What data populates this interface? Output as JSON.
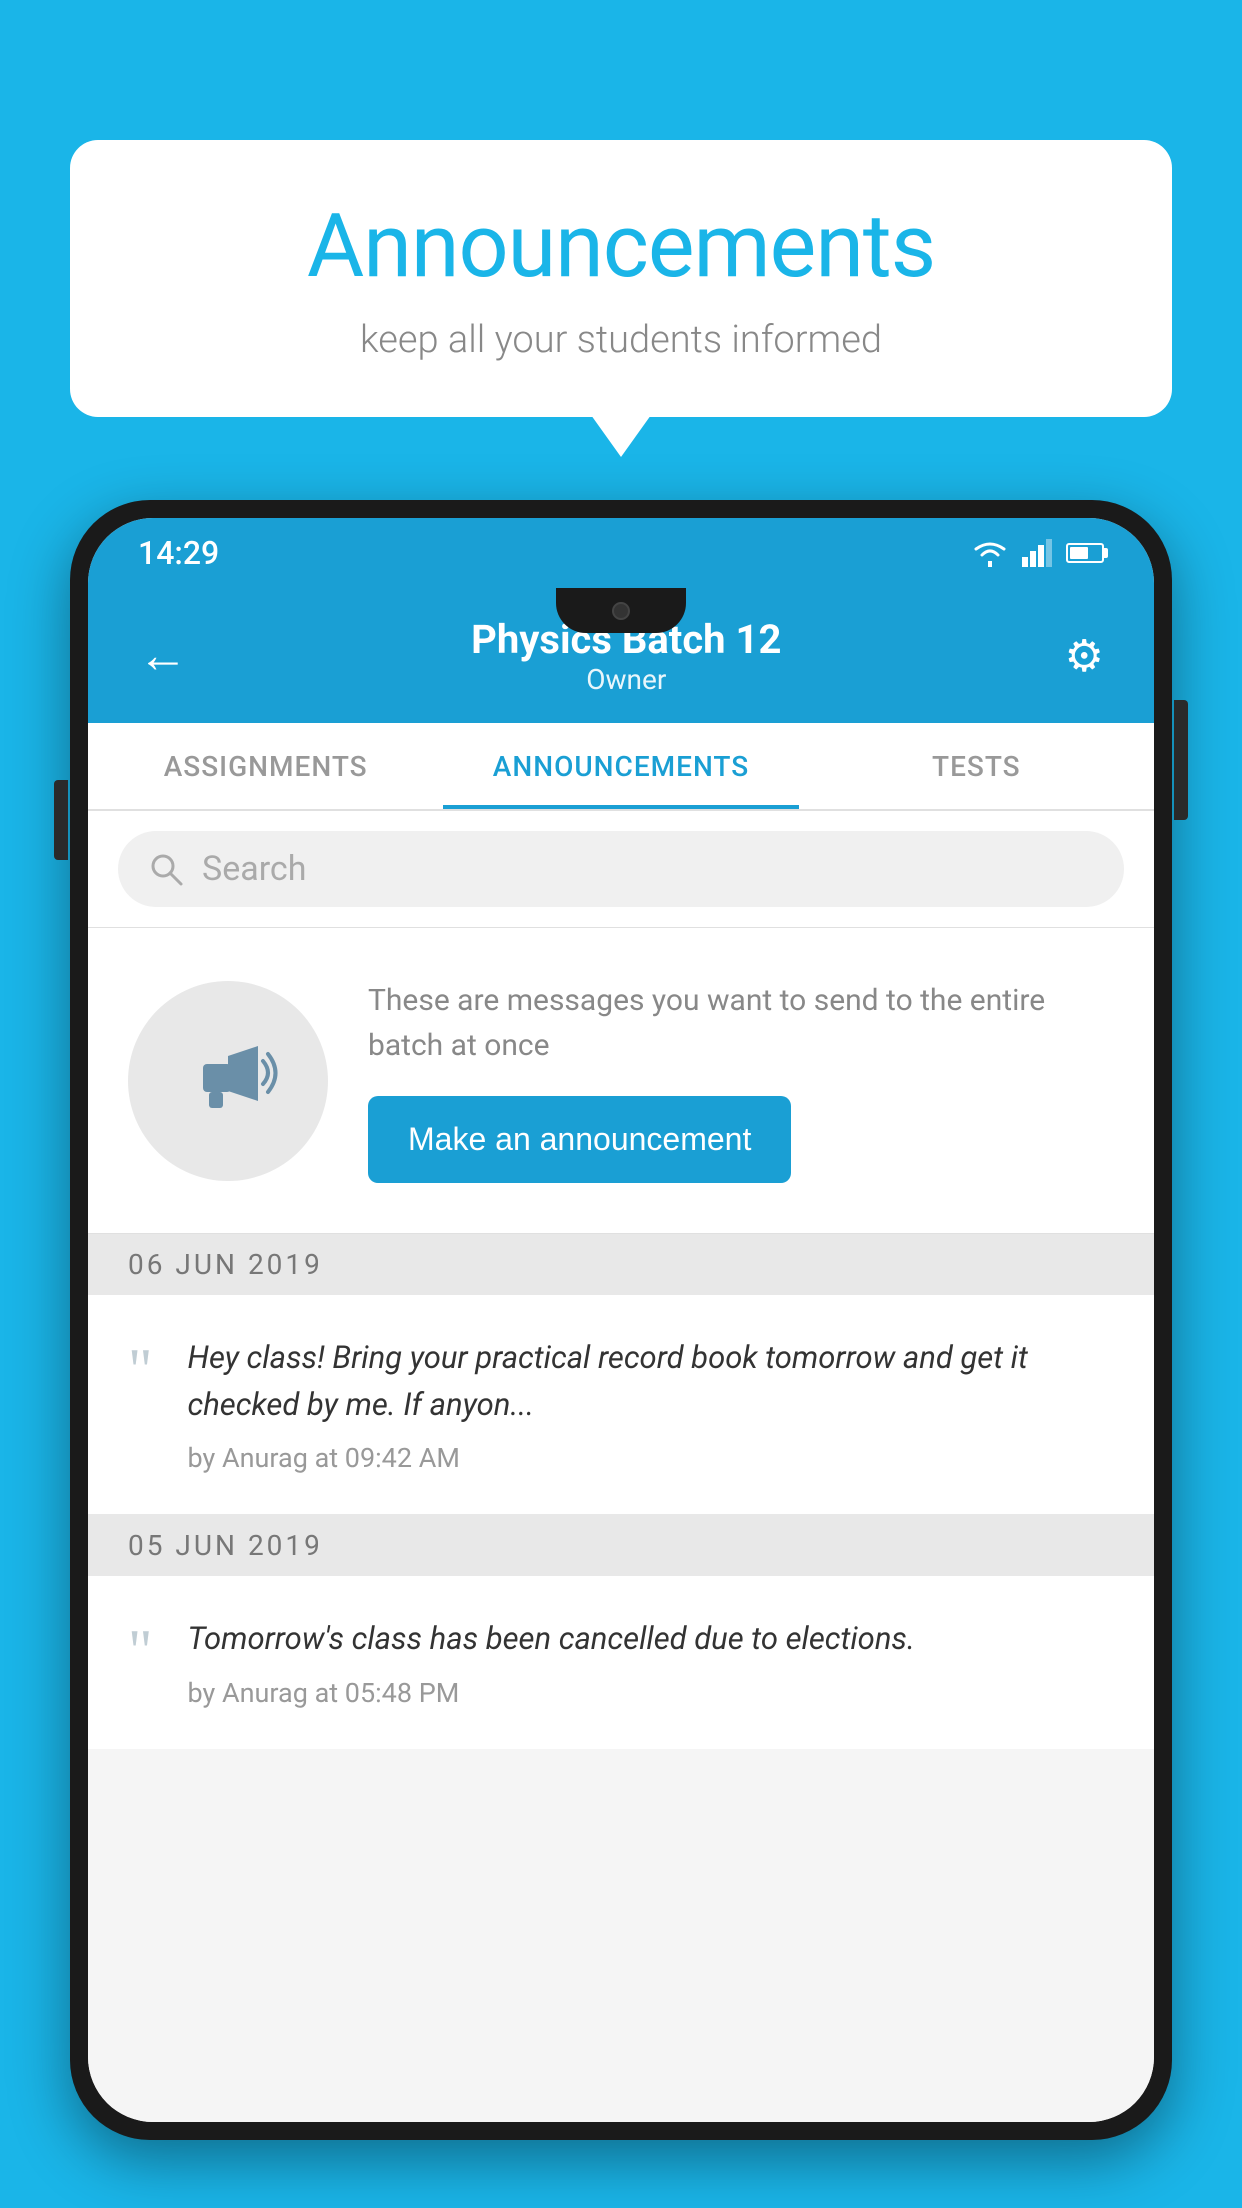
{
  "background_color": "#1ab5e8",
  "speech_bubble": {
    "title": "Announcements",
    "subtitle": "keep all your students informed"
  },
  "phone": {
    "status_bar": {
      "time": "14:29"
    },
    "header": {
      "title": "Physics Batch 12",
      "subtitle": "Owner",
      "back_label": "←",
      "settings_label": "⚙"
    },
    "tabs": [
      {
        "label": "ASSIGNMENTS",
        "active": false
      },
      {
        "label": "ANNOUNCEMENTS",
        "active": true
      },
      {
        "label": "TESTS",
        "active": false
      }
    ],
    "search": {
      "placeholder": "Search"
    },
    "announcement_placeholder": {
      "description": "These are messages you want to send to the entire batch at once",
      "button_label": "Make an announcement"
    },
    "date_sections": [
      {
        "date": "06  JUN  2019",
        "items": [
          {
            "text": "Hey class! Bring your practical record book tomorrow and get it checked by me. If anyon...",
            "meta": "by Anurag at 09:42 AM"
          }
        ]
      },
      {
        "date": "05  JUN  2019",
        "items": [
          {
            "text": "Tomorrow's class has been cancelled due to elections.",
            "meta": "by Anurag at 05:48 PM"
          }
        ]
      }
    ]
  }
}
